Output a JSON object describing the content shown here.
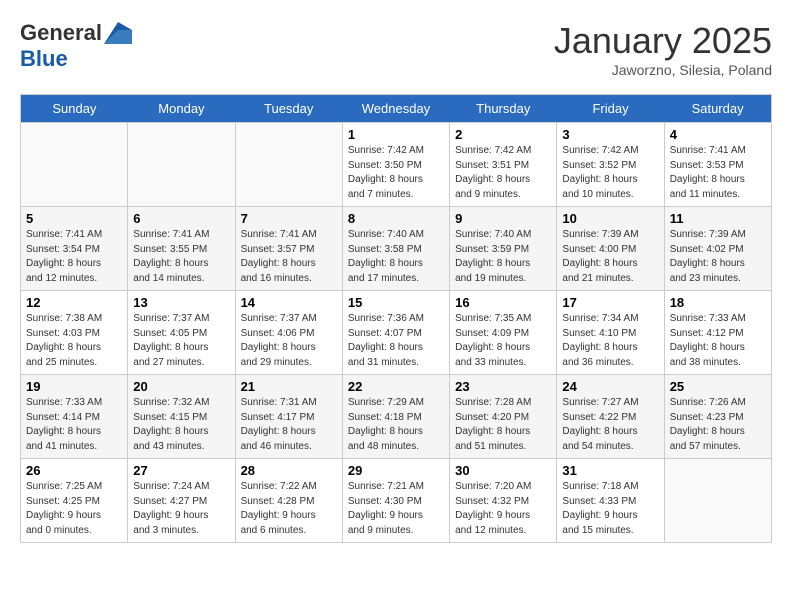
{
  "header": {
    "logo_general": "General",
    "logo_blue": "Blue",
    "month_title": "January 2025",
    "subtitle": "Jaworzno, Silesia, Poland"
  },
  "days_of_week": [
    "Sunday",
    "Monday",
    "Tuesday",
    "Wednesday",
    "Thursday",
    "Friday",
    "Saturday"
  ],
  "weeks": [
    [
      {
        "day": "",
        "info": ""
      },
      {
        "day": "",
        "info": ""
      },
      {
        "day": "",
        "info": ""
      },
      {
        "day": "1",
        "info": "Sunrise: 7:42 AM\nSunset: 3:50 PM\nDaylight: 8 hours\nand 7 minutes."
      },
      {
        "day": "2",
        "info": "Sunrise: 7:42 AM\nSunset: 3:51 PM\nDaylight: 8 hours\nand 9 minutes."
      },
      {
        "day": "3",
        "info": "Sunrise: 7:42 AM\nSunset: 3:52 PM\nDaylight: 8 hours\nand 10 minutes."
      },
      {
        "day": "4",
        "info": "Sunrise: 7:41 AM\nSunset: 3:53 PM\nDaylight: 8 hours\nand 11 minutes."
      }
    ],
    [
      {
        "day": "5",
        "info": "Sunrise: 7:41 AM\nSunset: 3:54 PM\nDaylight: 8 hours\nand 12 minutes."
      },
      {
        "day": "6",
        "info": "Sunrise: 7:41 AM\nSunset: 3:55 PM\nDaylight: 8 hours\nand 14 minutes."
      },
      {
        "day": "7",
        "info": "Sunrise: 7:41 AM\nSunset: 3:57 PM\nDaylight: 8 hours\nand 16 minutes."
      },
      {
        "day": "8",
        "info": "Sunrise: 7:40 AM\nSunset: 3:58 PM\nDaylight: 8 hours\nand 17 minutes."
      },
      {
        "day": "9",
        "info": "Sunrise: 7:40 AM\nSunset: 3:59 PM\nDaylight: 8 hours\nand 19 minutes."
      },
      {
        "day": "10",
        "info": "Sunrise: 7:39 AM\nSunset: 4:00 PM\nDaylight: 8 hours\nand 21 minutes."
      },
      {
        "day": "11",
        "info": "Sunrise: 7:39 AM\nSunset: 4:02 PM\nDaylight: 8 hours\nand 23 minutes."
      }
    ],
    [
      {
        "day": "12",
        "info": "Sunrise: 7:38 AM\nSunset: 4:03 PM\nDaylight: 8 hours\nand 25 minutes."
      },
      {
        "day": "13",
        "info": "Sunrise: 7:37 AM\nSunset: 4:05 PM\nDaylight: 8 hours\nand 27 minutes."
      },
      {
        "day": "14",
        "info": "Sunrise: 7:37 AM\nSunset: 4:06 PM\nDaylight: 8 hours\nand 29 minutes."
      },
      {
        "day": "15",
        "info": "Sunrise: 7:36 AM\nSunset: 4:07 PM\nDaylight: 8 hours\nand 31 minutes."
      },
      {
        "day": "16",
        "info": "Sunrise: 7:35 AM\nSunset: 4:09 PM\nDaylight: 8 hours\nand 33 minutes."
      },
      {
        "day": "17",
        "info": "Sunrise: 7:34 AM\nSunset: 4:10 PM\nDaylight: 8 hours\nand 36 minutes."
      },
      {
        "day": "18",
        "info": "Sunrise: 7:33 AM\nSunset: 4:12 PM\nDaylight: 8 hours\nand 38 minutes."
      }
    ],
    [
      {
        "day": "19",
        "info": "Sunrise: 7:33 AM\nSunset: 4:14 PM\nDaylight: 8 hours\nand 41 minutes."
      },
      {
        "day": "20",
        "info": "Sunrise: 7:32 AM\nSunset: 4:15 PM\nDaylight: 8 hours\nand 43 minutes."
      },
      {
        "day": "21",
        "info": "Sunrise: 7:31 AM\nSunset: 4:17 PM\nDaylight: 8 hours\nand 46 minutes."
      },
      {
        "day": "22",
        "info": "Sunrise: 7:29 AM\nSunset: 4:18 PM\nDaylight: 8 hours\nand 48 minutes."
      },
      {
        "day": "23",
        "info": "Sunrise: 7:28 AM\nSunset: 4:20 PM\nDaylight: 8 hours\nand 51 minutes."
      },
      {
        "day": "24",
        "info": "Sunrise: 7:27 AM\nSunset: 4:22 PM\nDaylight: 8 hours\nand 54 minutes."
      },
      {
        "day": "25",
        "info": "Sunrise: 7:26 AM\nSunset: 4:23 PM\nDaylight: 8 hours\nand 57 minutes."
      }
    ],
    [
      {
        "day": "26",
        "info": "Sunrise: 7:25 AM\nSunset: 4:25 PM\nDaylight: 9 hours\nand 0 minutes."
      },
      {
        "day": "27",
        "info": "Sunrise: 7:24 AM\nSunset: 4:27 PM\nDaylight: 9 hours\nand 3 minutes."
      },
      {
        "day": "28",
        "info": "Sunrise: 7:22 AM\nSunset: 4:28 PM\nDaylight: 9 hours\nand 6 minutes."
      },
      {
        "day": "29",
        "info": "Sunrise: 7:21 AM\nSunset: 4:30 PM\nDaylight: 9 hours\nand 9 minutes."
      },
      {
        "day": "30",
        "info": "Sunrise: 7:20 AM\nSunset: 4:32 PM\nDaylight: 9 hours\nand 12 minutes."
      },
      {
        "day": "31",
        "info": "Sunrise: 7:18 AM\nSunset: 4:33 PM\nDaylight: 9 hours\nand 15 minutes."
      },
      {
        "day": "",
        "info": ""
      }
    ]
  ]
}
